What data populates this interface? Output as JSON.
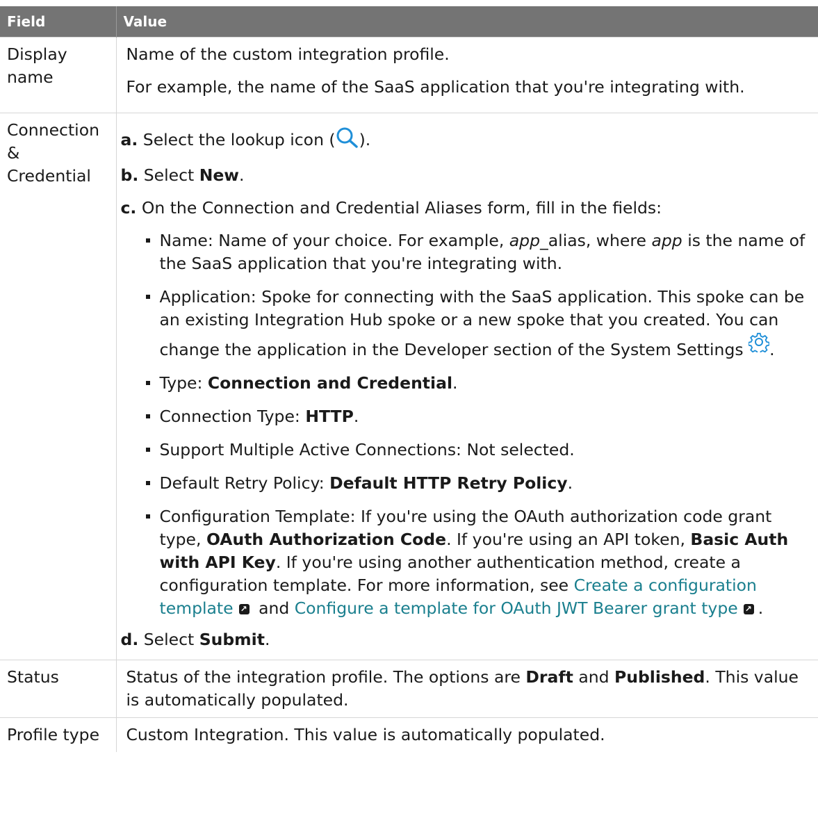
{
  "table": {
    "headers": [
      "Field",
      "Value"
    ],
    "rows": {
      "display": {
        "field": "Display name",
        "p1": "Name of the custom integration profile.",
        "p2": "For example, the name of the SaaS application that you're integrating with."
      },
      "connection": {
        "field_l1": "Connection",
        "field_l2": "&",
        "field_l3": "Credential",
        "step_a": {
          "label": "a.",
          "text": "Select the lookup icon (",
          "tail": ").",
          "icon": "lookup-icon"
        },
        "step_b": {
          "label": "b.",
          "text": "Select ",
          "bold": "New",
          "tail": "."
        },
        "step_c": {
          "label": "c.",
          "text": "On the Connection and Credential Aliases form, fill in the fields:"
        },
        "bullets": {
          "name": {
            "pre": "Name: Name of your choice. For example, ",
            "em1": "app",
            "mid": "_alias, where ",
            "em2": "app",
            "post": " is the name of the SaaS application that you're integrating with."
          },
          "application": {
            "pre": "Application: Spoke for connecting with the SaaS application. This spoke can be an existing Integration Hub spoke or a new spoke that you created. You can change the application in the Developer section of the System Settings ",
            "icon": "gear-icon",
            "post": "."
          },
          "type": {
            "pre": "Type: ",
            "bold": "Connection and Credential",
            "post": "."
          },
          "conn_type": {
            "pre": "Connection Type: ",
            "bold": "HTTP",
            "post": "."
          },
          "multi": {
            "text": "Support Multiple Active Connections: Not selected."
          },
          "retry": {
            "pre": "Default Retry Policy: ",
            "bold": "Default HTTP Retry Policy",
            "post": "."
          },
          "config": {
            "pre": "Configuration Template: If you're using the OAuth authorization code grant type, ",
            "bold1": "OAuth Authorization Code",
            "mid1": ". If you're using an API token, ",
            "bold2": "Basic Auth with API Key",
            "mid2": ". If you're using another authentication method, create a configuration template. For more information, see ",
            "link1": "Create a configuration template",
            "and": " and ",
            "link2": "Configure a template for OAuth JWT Bearer grant type",
            "post": "."
          }
        },
        "step_d": {
          "label": "d.",
          "text": "Select ",
          "bold": "Submit",
          "tail": "."
        }
      },
      "status": {
        "field": "Status",
        "pre": "Status of the integration profile. The options are ",
        "bold1": "Draft",
        "and": " and ",
        "bold2": "Published",
        "post": ". This value is automatically populated."
      },
      "profile_type": {
        "field": "Profile type",
        "text": "Custom Integration. This value is automatically populated."
      }
    }
  },
  "colors": {
    "header_bg": "#747474",
    "link": "#1a7f8e",
    "icon_blue": "#1f8fd8",
    "border": "#d6d6d6"
  }
}
